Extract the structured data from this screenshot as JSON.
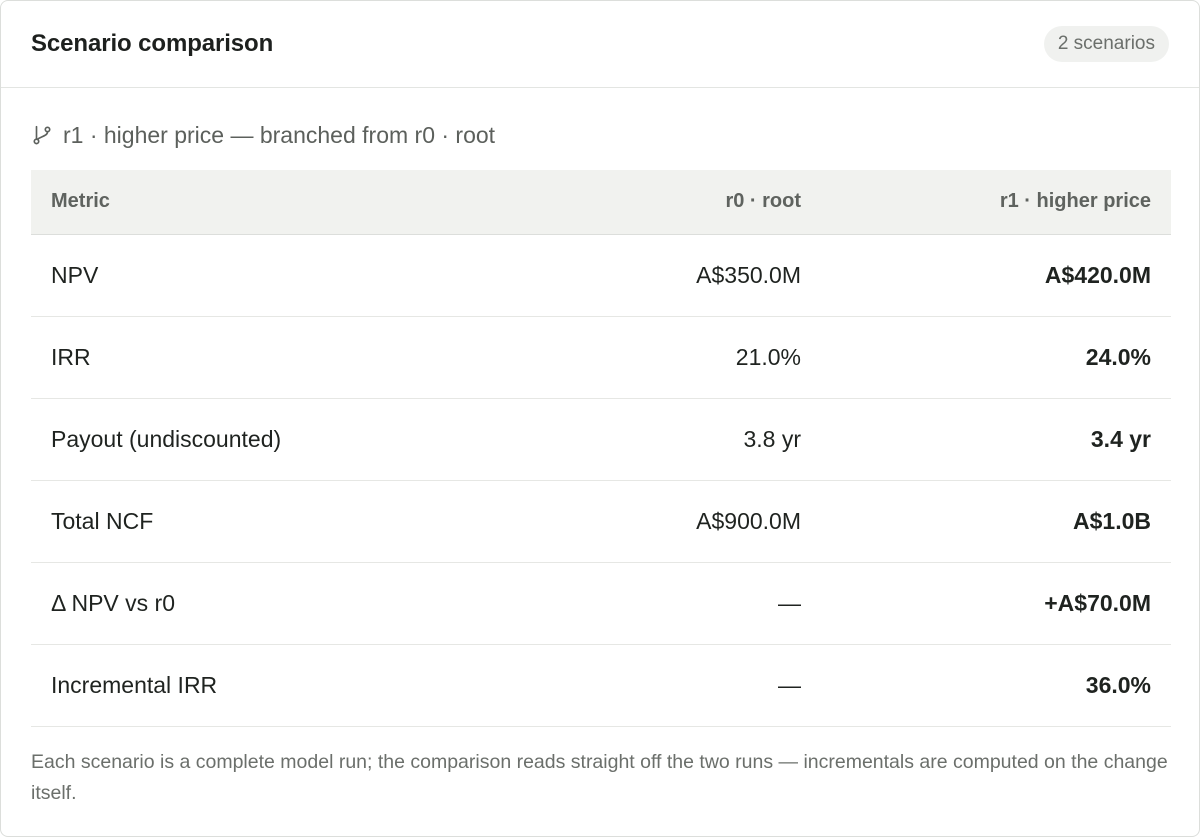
{
  "header": {
    "title": "Scenario comparison",
    "badge": "2 scenarios"
  },
  "lineage": {
    "icon": "git-branch-icon",
    "text": "r1 · higher price — branched from r0 · root"
  },
  "table": {
    "columns": [
      "Metric",
      "r0 · root",
      "r1 · higher price"
    ],
    "rows": [
      [
        "NPV",
        "A$350.0M",
        "A$420.0M"
      ],
      [
        "IRR",
        "21.0%",
        "24.0%"
      ],
      [
        "Payout (undiscounted)",
        "3.8 yr",
        "3.4 yr"
      ],
      [
        "Total NCF",
        "A$900.0M",
        "A$1.0B"
      ],
      [
        "Δ NPV vs r0",
        "—",
        "+A$70.0M"
      ],
      [
        "Incremental IRR",
        "—",
        "36.0%"
      ]
    ]
  },
  "footnote": "Each scenario is a complete model run; the comparison reads straight off the two runs — incrementals are computed on the change itself."
}
